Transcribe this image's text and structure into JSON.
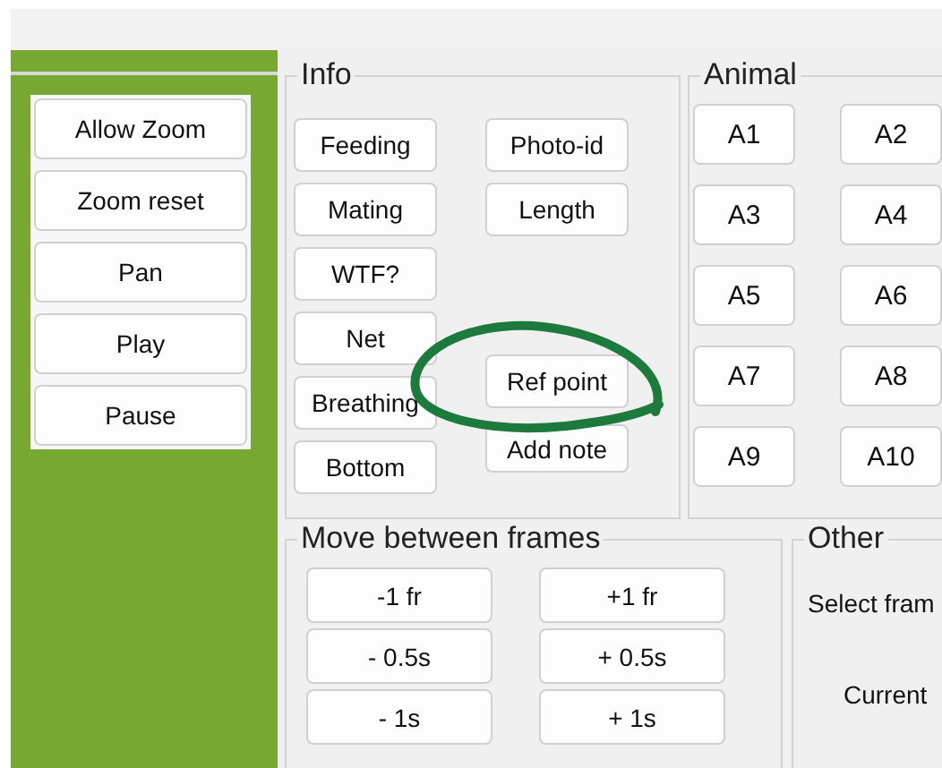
{
  "sidebar": {
    "buttons": [
      "Allow Zoom",
      "Zoom reset",
      "Pan",
      "Play",
      "Pause"
    ]
  },
  "info": {
    "title": "Info",
    "column_1": [
      "Feeding",
      "Mating",
      "WTF?",
      "Net",
      "Breathing",
      "Bottom"
    ],
    "column_2": [
      "Photo-id",
      "Length",
      "Ref point",
      "Add note"
    ]
  },
  "animal": {
    "title": "Animal",
    "buttons": [
      "A1",
      "A2",
      "A3",
      "A4",
      "A5",
      "A6",
      "A7",
      "A8",
      "A9",
      "A10"
    ]
  },
  "move_between_frames": {
    "title": "Move between frames",
    "buttons": [
      "-1 fr",
      "+1 fr",
      "- 0.5s",
      "+ 0.5s",
      "- 1s",
      "+ 1s"
    ]
  },
  "other": {
    "title": "Other",
    "labels": [
      "Select fram",
      "Current"
    ]
  }
}
